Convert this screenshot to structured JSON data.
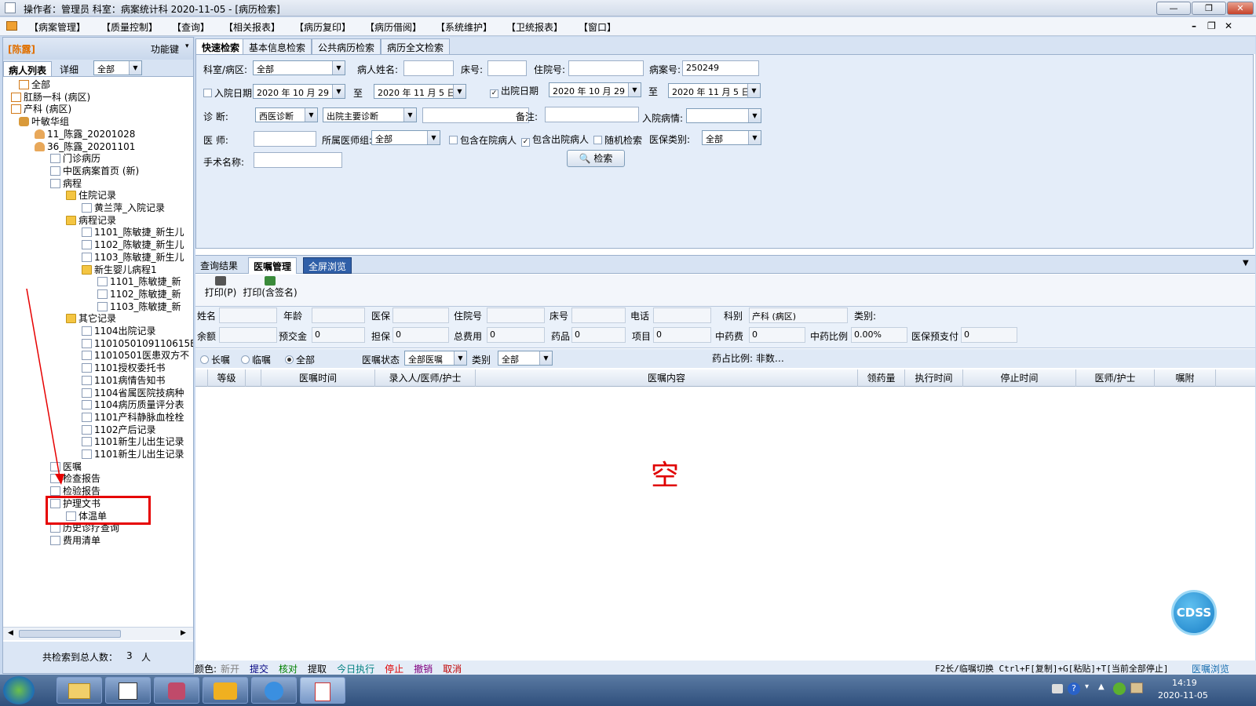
{
  "titlebar": {
    "title": "操作者：管理员  科室：病案统计科  2020-11-05 - [病历检索]"
  },
  "menu": {
    "items": [
      "【病案管理】",
      "【质量控制】",
      "【查询】",
      "【相关报表】",
      "【病历复印】",
      "【病历借阅】",
      "【系统维护】",
      "【卫统报表】",
      "【窗口】"
    ]
  },
  "left": {
    "patient": "[陈露]",
    "func_key": "功能键",
    "tab_list": "病人列表",
    "tab_detail": "详细",
    "filter": "全部",
    "tree": [
      {
        "label": "全部",
        "icon": "plus"
      },
      {
        "label": "肛肠一科 (病区)",
        "icon": "plus"
      },
      {
        "label": "产科 (病区)",
        "icon": "plus"
      },
      {
        "label": "叶敏华组",
        "icon": "group"
      },
      {
        "label": "11_陈露_20201028",
        "icon": "person"
      },
      {
        "label": "36_陈露_20201101",
        "icon": "person"
      },
      {
        "label": "门诊病历",
        "icon": "doc"
      },
      {
        "label": "中医病案首页 (新)",
        "icon": "doc"
      },
      {
        "label": "病程",
        "icon": "doc"
      },
      {
        "label": "住院记录",
        "icon": "folder"
      },
      {
        "label": "黄兰萍_入院记录",
        "icon": "doc"
      },
      {
        "label": "病程记录",
        "icon": "folder"
      },
      {
        "label": "1101_陈敏捷_新生儿",
        "icon": "doc"
      },
      {
        "label": "1102_陈敏捷_新生儿",
        "icon": "doc"
      },
      {
        "label": "1103_陈敏捷_新生儿",
        "icon": "doc"
      },
      {
        "label": "新生婴儿病程1",
        "icon": "folder"
      },
      {
        "label": "1101_陈敏捷_新",
        "icon": "doc"
      },
      {
        "label": "1102_陈敏捷_新",
        "icon": "doc"
      },
      {
        "label": "1103_陈敏捷_新",
        "icon": "doc"
      },
      {
        "label": "其它记录",
        "icon": "folder"
      },
      {
        "label": "1104出院记录",
        "icon": "doc"
      },
      {
        "label": "1101050109110615E",
        "icon": "doc"
      },
      {
        "label": "11010501医患双方不",
        "icon": "doc"
      },
      {
        "label": "1101授权委托书",
        "icon": "doc"
      },
      {
        "label": "1101病情告知书",
        "icon": "doc"
      },
      {
        "label": "1104省属医院技病种",
        "icon": "doc"
      },
      {
        "label": "1104病历质量评分表",
        "icon": "doc"
      },
      {
        "label": "1101产科静脉血栓栓",
        "icon": "doc"
      },
      {
        "label": "1102产后记录",
        "icon": "doc"
      },
      {
        "label": "1101新生儿出生记录",
        "icon": "doc"
      },
      {
        "label": "1101新生儿出生记录",
        "icon": "doc"
      },
      {
        "label": "医嘱",
        "icon": "doc"
      },
      {
        "label": "检查报告",
        "icon": "doc"
      },
      {
        "label": "检验报告",
        "icon": "doc"
      },
      {
        "label": "护理文书",
        "icon": "doc"
      },
      {
        "label": "体温单",
        "icon": "doc"
      },
      {
        "label": "历史诊疗查询",
        "icon": "doc"
      },
      {
        "label": "费用清单",
        "icon": "doc"
      }
    ],
    "footer_label": "共检索到总人数：",
    "footer_count": "3",
    "footer_unit": "人"
  },
  "search": {
    "tabs": [
      "快速检索",
      "基本信息检索",
      "公共病历检索",
      "病历全文检索"
    ],
    "dept_label": "科室/病区:",
    "dept_value": "全部",
    "name_label": "病人姓名:",
    "bed_label": "床号:",
    "inpno_label": "住院号:",
    "caseno_label": "病案号:",
    "caseno_value": "250249",
    "admit_label": "入院日期",
    "admit_from": "2020 年 10 月 29",
    "to": "至",
    "admit_to": "2020 年 11 月  5 日",
    "discharge_label": "出院日期",
    "discharge_from": "2020 年 10 月 29",
    "discharge_to": "2020 年 11 月  5 日",
    "diag_label": "诊    断:",
    "diag_type": "西医诊断",
    "diag_main": "出院主要诊断",
    "remark_label": "备注:",
    "admit_cond_label": "入院病情:",
    "doctor_label": "医    师:",
    "group_label": "所属医师组:",
    "group_value": "全部",
    "incl_in": "包含在院病人",
    "incl_out": "包含出院病人",
    "random": "随机检索",
    "insure_label": "医保类别:",
    "insure_value": "全部",
    "surgery_label": "手术名称:",
    "search_btn": "检索"
  },
  "result": {
    "tabs": [
      "查询结果",
      "医嘱管理",
      "全屏浏览"
    ],
    "print": "打印(P)",
    "print_sign": "打印(含签名)",
    "info_labels": [
      "姓名",
      "年龄",
      "医保",
      "住院号",
      "床号",
      "电话",
      "科别",
      "类别:",
      "余额",
      "预交金",
      "担保",
      "总费用",
      "药品",
      "项目",
      "中药费",
      "中药比例",
      "医保预支付"
    ],
    "dept": "产科 (病区)",
    "prepay": "0",
    "guarantee": "0",
    "total": "0",
    "drug": "0",
    "item": "0",
    "herb": "0",
    "herb_ratio": "0.00%",
    "insure_pre": "0",
    "radio_long": "长嘱",
    "radio_temp": "临嘱",
    "radio_all": "全部",
    "status_label": "医嘱状态",
    "status_value": "全部医嘱",
    "type_label": "类别",
    "type_value": "全部",
    "ratio_label": "药占比例: 非数…",
    "columns": [
      "等级",
      "医嘱时间",
      "录入人/医师/护士",
      "医嘱内容",
      "领药量",
      "执行时间",
      "停止时间",
      "医师/护士",
      "嘱附"
    ],
    "empty": "空"
  },
  "status": {
    "color_label": "颜色:",
    "legend": [
      {
        "t": "新开",
        "c": "#808080"
      },
      {
        "t": "提交",
        "c": "#000080"
      },
      {
        "t": "核对",
        "c": "#008000"
      },
      {
        "t": "提取",
        "c": "#000000"
      },
      {
        "t": "今日执行",
        "c": "#008080"
      },
      {
        "t": "停止",
        "c": "#e00000"
      },
      {
        "t": "撤销",
        "c": "#800080"
      },
      {
        "t": "取消",
        "c": "#c00000"
      }
    ],
    "hint": "F2长/临嘱切换 Ctrl+F[复制]+G[粘贴]+T[当前全部停止]",
    "view": "医嘱浏览"
  },
  "cdss": "CDSS",
  "taskbar": {
    "time": "14:19",
    "date": "2020-11-05"
  }
}
